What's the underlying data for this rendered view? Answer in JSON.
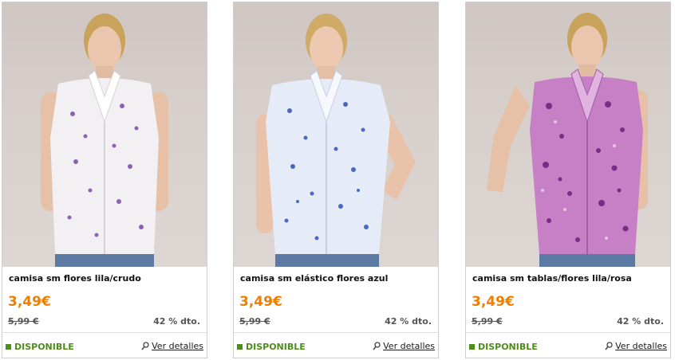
{
  "products": [
    {
      "name": "camisa sm flores lila/crudo",
      "price": "3,49€",
      "old_price": "5,99 €",
      "discount": "42 % dto.",
      "status": "DISPONIBLE",
      "details_label": "Ver detalles",
      "shirt_color": "#f3f0f4",
      "print_color": "#8a63b8"
    },
    {
      "name": "camisa sm elástico flores azul",
      "price": "3,49€",
      "old_price": "5,99 €",
      "discount": "42 % dto.",
      "status": "DISPONIBLE",
      "details_label": "Ver detalles",
      "shirt_color": "#e6ecf7",
      "print_color": "#4b67c2"
    },
    {
      "name": "camisa sm tablas/flores lila/rosa",
      "price": "3,49€",
      "old_price": "5,99 €",
      "discount": "42 % dto.",
      "status": "DISPONIBLE",
      "details_label": "Ver detalles",
      "shirt_color": "#c77fc6",
      "print_color": "#7a2d86"
    }
  ],
  "colors": {
    "price": "#ef7d00",
    "available": "#4e8d1a",
    "border": "#cfcfcf"
  },
  "icons": {
    "availability": "green-square-icon",
    "details": "magnifier-icon"
  }
}
